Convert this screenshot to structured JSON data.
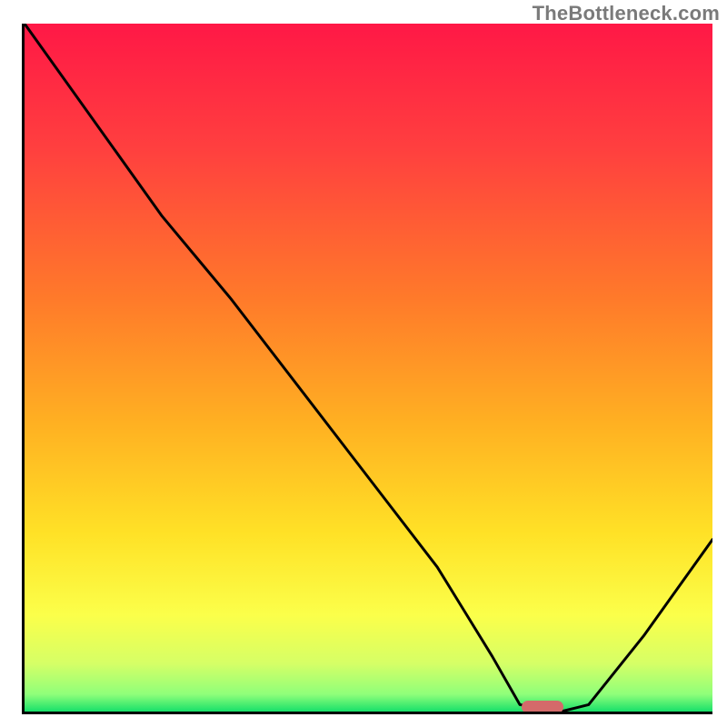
{
  "watermark": "TheBottleneck.com",
  "chart_data": {
    "type": "line",
    "title": "",
    "xlabel": "",
    "ylabel": "",
    "xlim": [
      0,
      100
    ],
    "ylim": [
      0,
      100
    ],
    "series": [
      {
        "name": "bottleneck-curve",
        "x": [
          0,
          10,
          20,
          25,
          30,
          40,
          50,
          60,
          68,
          72,
          78,
          82,
          90,
          100
        ],
        "y": [
          100,
          86,
          72,
          66,
          60,
          47,
          34,
          21,
          8,
          1,
          0,
          1,
          11,
          25
        ]
      }
    ],
    "marker": {
      "name": "optimal-range",
      "x_start": 72,
      "x_end": 78,
      "y": 0,
      "color": "#d46a6a"
    },
    "gradient_stops": [
      {
        "offset": 0.0,
        "color": "#ff1846"
      },
      {
        "offset": 0.18,
        "color": "#ff3f3f"
      },
      {
        "offset": 0.4,
        "color": "#ff7a2a"
      },
      {
        "offset": 0.58,
        "color": "#ffb022"
      },
      {
        "offset": 0.74,
        "color": "#ffe126"
      },
      {
        "offset": 0.86,
        "color": "#fbff4a"
      },
      {
        "offset": 0.93,
        "color": "#d6ff66"
      },
      {
        "offset": 0.975,
        "color": "#8fff7a"
      },
      {
        "offset": 1.0,
        "color": "#17e06a"
      }
    ]
  }
}
